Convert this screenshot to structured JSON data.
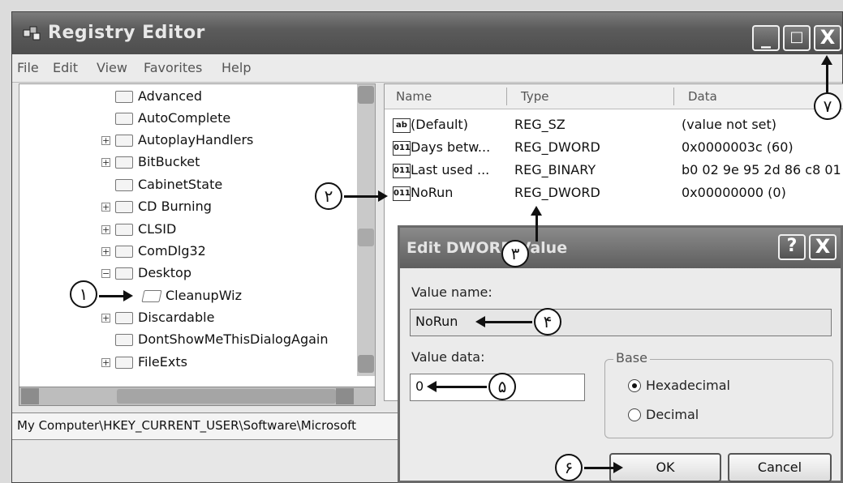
{
  "window": {
    "title": "Registry Editor",
    "buttons": {
      "minimize": "_",
      "maximize": "□",
      "close": "X"
    }
  },
  "menu": [
    "File",
    "Edit",
    "View",
    "Favorites",
    "Help"
  ],
  "tree": {
    "items": [
      {
        "label": "Advanced",
        "expander": ""
      },
      {
        "label": "AutoComplete",
        "expander": ""
      },
      {
        "label": "AutoplayHandlers",
        "expander": "+"
      },
      {
        "label": "BitBucket",
        "expander": "+"
      },
      {
        "label": "CabinetState",
        "expander": ""
      },
      {
        "label": "CD Burning",
        "expander": "+"
      },
      {
        "label": "CLSID",
        "expander": "+"
      },
      {
        "label": "ComDlg32",
        "expander": "+"
      },
      {
        "label": "Desktop",
        "expander": "−"
      },
      {
        "label": "CleanupWiz",
        "expander": ""
      },
      {
        "label": "Discardable",
        "expander": "+"
      },
      {
        "label": "DontShowMeThisDialogAgain",
        "expander": ""
      },
      {
        "label": "FileExts",
        "expander": "+"
      }
    ]
  },
  "list": {
    "columns": [
      "Name",
      "Type",
      "Data"
    ],
    "rows": [
      {
        "icon": "ab",
        "name": "(Default)",
        "type": "REG_SZ",
        "data": "(value not set)"
      },
      {
        "icon": "011",
        "name": "Days betw...",
        "type": "REG_DWORD",
        "data": "0x0000003c (60)"
      },
      {
        "icon": "011",
        "name": "Last used ...",
        "type": "REG_BINARY",
        "data": "b0 02 9e 95 2d 86 c8 01"
      },
      {
        "icon": "011",
        "name": "NoRun",
        "type": "REG_DWORD",
        "data": "0x00000000 (0)"
      }
    ]
  },
  "status": "My Computer\\HKEY_CURRENT_USER\\Software\\Microsoft",
  "dialog": {
    "title": "Edit DWORD Value",
    "help_button": "?",
    "close_button": "X",
    "value_name_label": "Value name:",
    "value_name": "NoRun",
    "value_data_label": "Value data:",
    "value_data": "0",
    "base_label": "Base",
    "radio_hex": "Hexadecimal",
    "radio_dec": "Decimal",
    "hex_selected": true,
    "ok": "OK",
    "cancel": "Cancel"
  },
  "callouts": [
    "۱",
    "۲",
    "۳",
    "۴",
    "۵",
    "۶",
    "۷"
  ]
}
